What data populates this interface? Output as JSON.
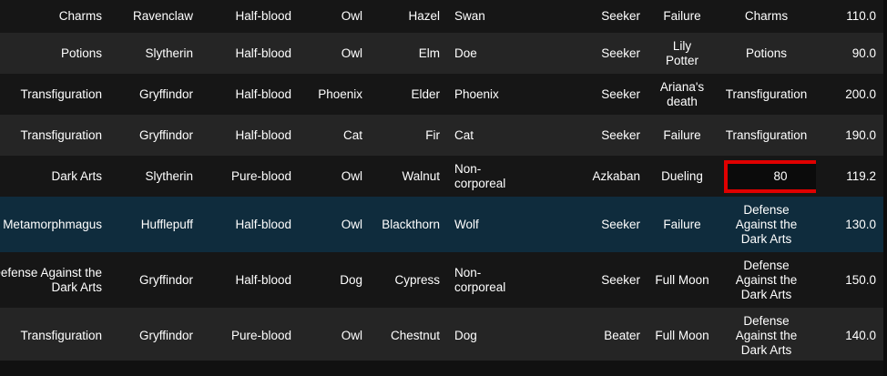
{
  "rows": [
    {
      "course": "Charms",
      "house": "Ravenclaw",
      "blood": "Half-blood",
      "pet": "Owl",
      "wood": "Hazel",
      "patronus": "Swan",
      "position": "Seeker",
      "boggart": "Failure",
      "subject": "Charms",
      "value": "110.0",
      "state": "even"
    },
    {
      "course": "Potions",
      "house": "Slytherin",
      "blood": "Half-blood",
      "pet": "Owl",
      "wood": "Elm",
      "patronus": "Doe",
      "position": "Seeker",
      "boggart": "Lily Potter",
      "subject": "Potions",
      "value": "90.0",
      "state": "odd"
    },
    {
      "course": "Transfiguration",
      "house": "Gryffindor",
      "blood": "Half-blood",
      "pet": "Phoenix",
      "wood": "Elder",
      "patronus": "Phoenix",
      "position": "Seeker",
      "boggart": "Ariana's death",
      "subject": "Transfiguration",
      "value": "200.0",
      "state": "even"
    },
    {
      "course": "Transfiguration",
      "house": "Gryffindor",
      "blood": "Half-blood",
      "pet": "Cat",
      "wood": "Fir",
      "patronus": "Cat",
      "position": "Seeker",
      "boggart": "Failure",
      "subject": "Transfiguration",
      "value": "190.0",
      "state": "odd"
    },
    {
      "course": "Dark Arts",
      "house": "Slytherin",
      "blood": "Pure-blood",
      "pet": "Owl",
      "wood": "Walnut",
      "patronus": "Non-corporeal",
      "position": "Azkaban",
      "boggart": "Dueling",
      "subject": "80",
      "value": "119.2",
      "state": "even",
      "editing": true
    },
    {
      "course": "Metamorphmagus",
      "house": "Hufflepuff",
      "blood": "Half-blood",
      "pet": "Owl",
      "wood": "Blackthorn",
      "patronus": "Wolf",
      "position": "Seeker",
      "boggart": "Failure",
      "subject": "Defense Against the Dark Arts",
      "value": "130.0",
      "state": "selected"
    },
    {
      "course": "Defense Against the Dark Arts",
      "house": "Gryffindor",
      "blood": "Half-blood",
      "pet": "Dog",
      "wood": "Cypress",
      "patronus": "Non-corporeal",
      "position": "Seeker",
      "boggart": "Full Moon",
      "subject": "Defense Against the Dark Arts",
      "value": "150.0",
      "state": "even"
    },
    {
      "course": "Transfiguration",
      "house": "Gryffindor",
      "blood": "Pure-blood",
      "pet": "Owl",
      "wood": "Chestnut",
      "patronus": "Dog",
      "position": "Beater",
      "boggart": "Full Moon",
      "subject": "Defense Against the Dark Arts",
      "value": "140.0",
      "state": "odd"
    }
  ],
  "colors": {
    "background": "#111111",
    "row_even": "#161616",
    "row_odd": "#252525",
    "row_selected": "#0f2c3d",
    "edit_border": "#e00000",
    "text": "#ffffff"
  }
}
